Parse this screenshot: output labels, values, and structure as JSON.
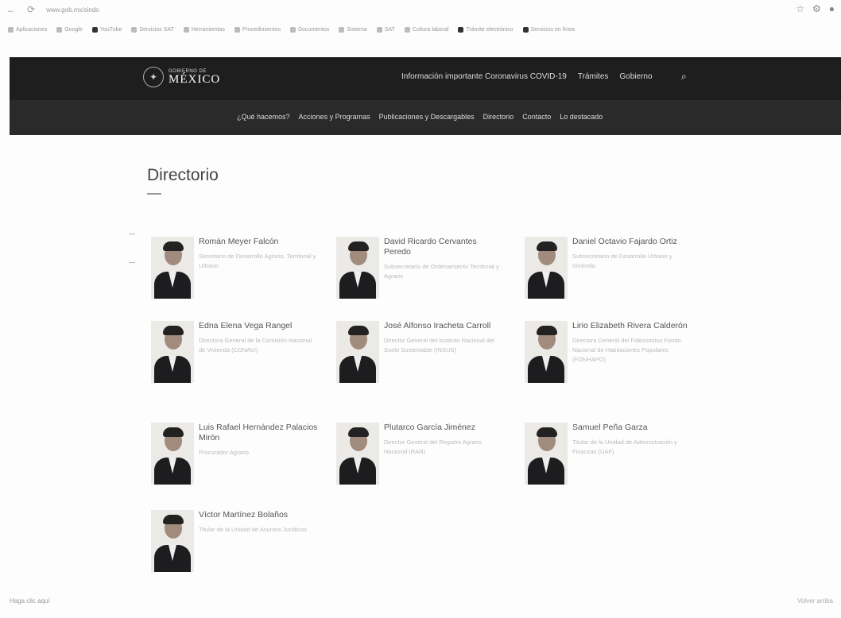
{
  "browser": {
    "url": "www.gob.mx/sindo",
    "bookmarks": [
      "Aplicaciones",
      "Google",
      "YouTube",
      "Servicios SAT",
      "Herramientas",
      "Procedimientos",
      "Documentos",
      "Sistema",
      "SAT",
      "Cultura laboral",
      "Trámite electrónico",
      "Servicios en línea"
    ]
  },
  "header": {
    "logo_small": "GOBIERNO DE",
    "logo_big": "MÉXICO",
    "top_nav": [
      "Información importante Coronavirus COVID-19",
      "Trámites",
      "Gobierno"
    ],
    "sub_nav": [
      "¿Qué hacemos?",
      "Acciones y Programas",
      "Publicaciones y Descargables",
      "Directorio",
      "Contacto",
      "Lo destacado"
    ]
  },
  "page": {
    "title": "Directorio"
  },
  "people": [
    {
      "name": "Román Meyer Falcón",
      "role": "Secretario de Desarrollo Agrario, Territorial y Urbano"
    },
    {
      "name": "David Ricardo Cervantes Peredo",
      "role": "Subsecretario de Ordenamiento Territorial y Agrario"
    },
    {
      "name": "Daniel Octavio Fajardo Ortiz",
      "role": "Subsecretario de Desarrollo Urbano y Vivienda"
    },
    {
      "name": "Edna Elena Vega Rangel",
      "role": "Directora General de la Comisión Nacional de Vivienda (CONAVI)"
    },
    {
      "name": "José Alfonso Iracheta Carroll",
      "role": "Director General del Instituto Nacional del Suelo Sustentable (INSUS)"
    },
    {
      "name": "Lirio Elizabeth Rivera Calderón",
      "role": "Directora General del Fideicomiso Fondo Nacional de Habitaciones Populares (FONHAPO)"
    },
    {
      "name": "Luis Rafael Hernández Palacios Mirón",
      "role": "Procurador Agrario"
    },
    {
      "name": "Plutarco García Jiménez",
      "role": "Director General del Registro Agrario Nacional (RAN)"
    },
    {
      "name": "Samuel Peña Garza",
      "role": "Titular de la Unidad de Administración y Finanzas (UAF)"
    },
    {
      "name": "Víctor Martínez Bolaños",
      "role": "Titular de la Unidad de Asuntos Jurídicos"
    }
  ],
  "footer": {
    "left": "Haga clic aquí",
    "right": "Volver arriba"
  }
}
